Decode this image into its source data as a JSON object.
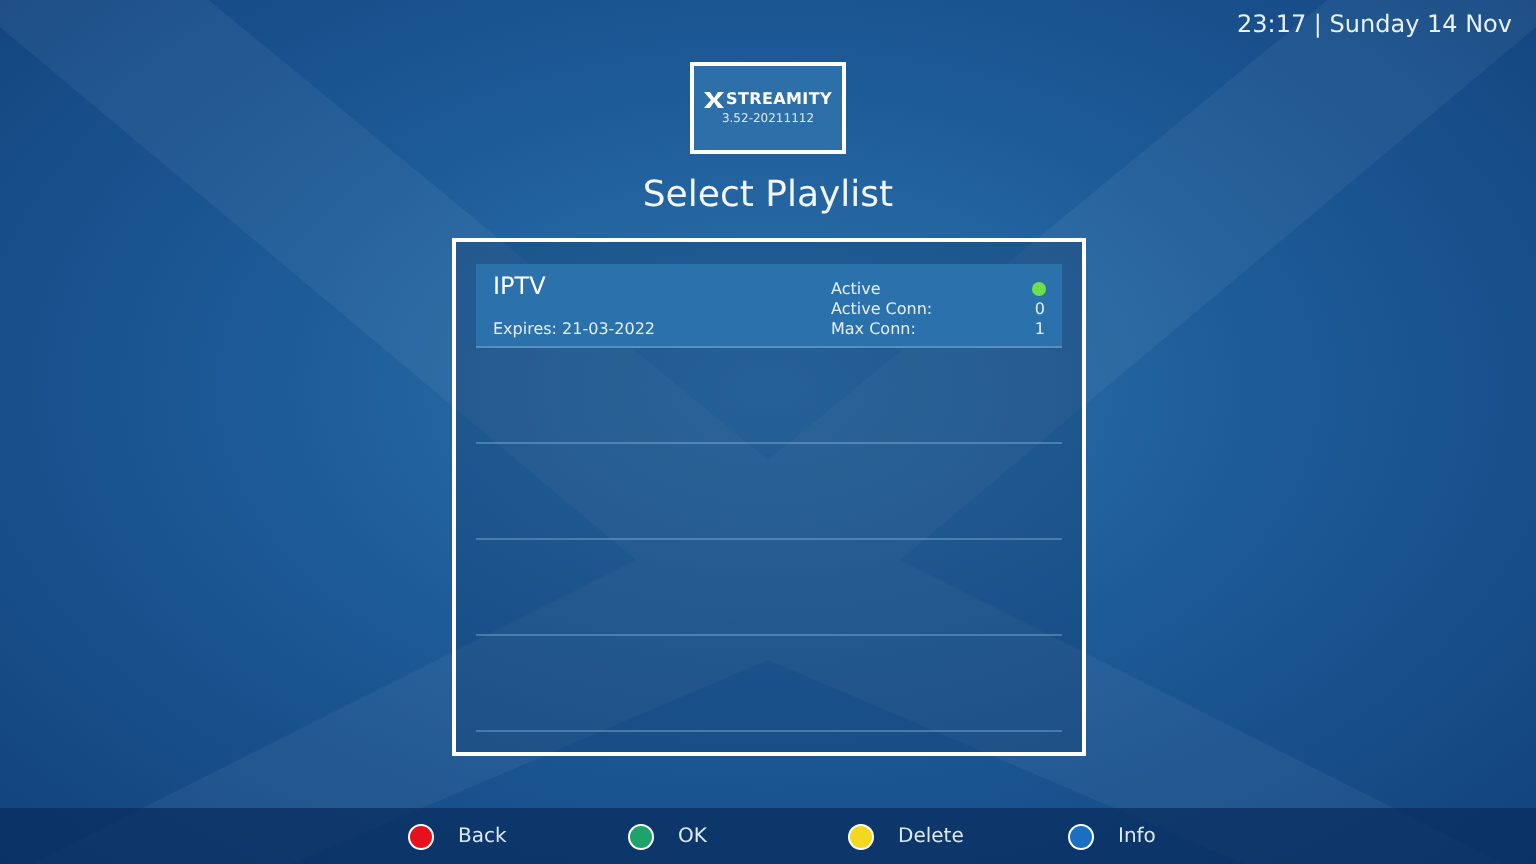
{
  "clock": "23:17 | Sunday 14 Nov",
  "logo": {
    "name": "STREAMITY",
    "version": "3.52-20211112"
  },
  "title": "Select Playlist",
  "playlists": [
    {
      "name": "IPTV",
      "expires": "Expires: 21-03-2022",
      "status_label": "Active",
      "active": true,
      "active_conn_label": "Active Conn:",
      "active_conn": "0",
      "max_conn_label": "Max Conn:",
      "max_conn": "1",
      "selected": true
    }
  ],
  "buttons": [
    {
      "label": "Back",
      "color": "#e8101c"
    },
    {
      "label": "OK",
      "color": "#1ea36a"
    },
    {
      "label": "Delete",
      "color": "#f2d81e"
    },
    {
      "label": "Info",
      "color": "#1a6fc0"
    }
  ]
}
